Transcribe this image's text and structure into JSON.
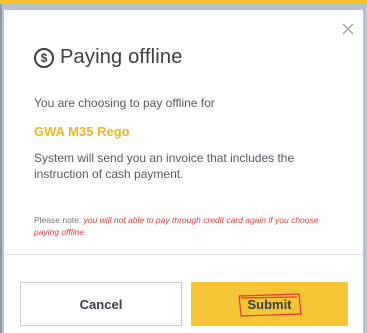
{
  "modal": {
    "title": "Paying offline",
    "dollar_symbol": "$",
    "close_icon": "close-icon",
    "intro": "You are choosing to pay offline for",
    "product": "GWA M35 Rego",
    "description": "System will send you an invoice that includes the instruction of cash payment.",
    "note_label": "Please note:",
    "note_warning": "you will not able to pay through credit card again if you choose paying offline",
    "cancel_label": "Cancel",
    "submit_label": "Submit"
  },
  "colors": {
    "accent": "#f4c534",
    "product": "#f2b51d",
    "warning": "#e53935",
    "annotation": "#e53935"
  }
}
